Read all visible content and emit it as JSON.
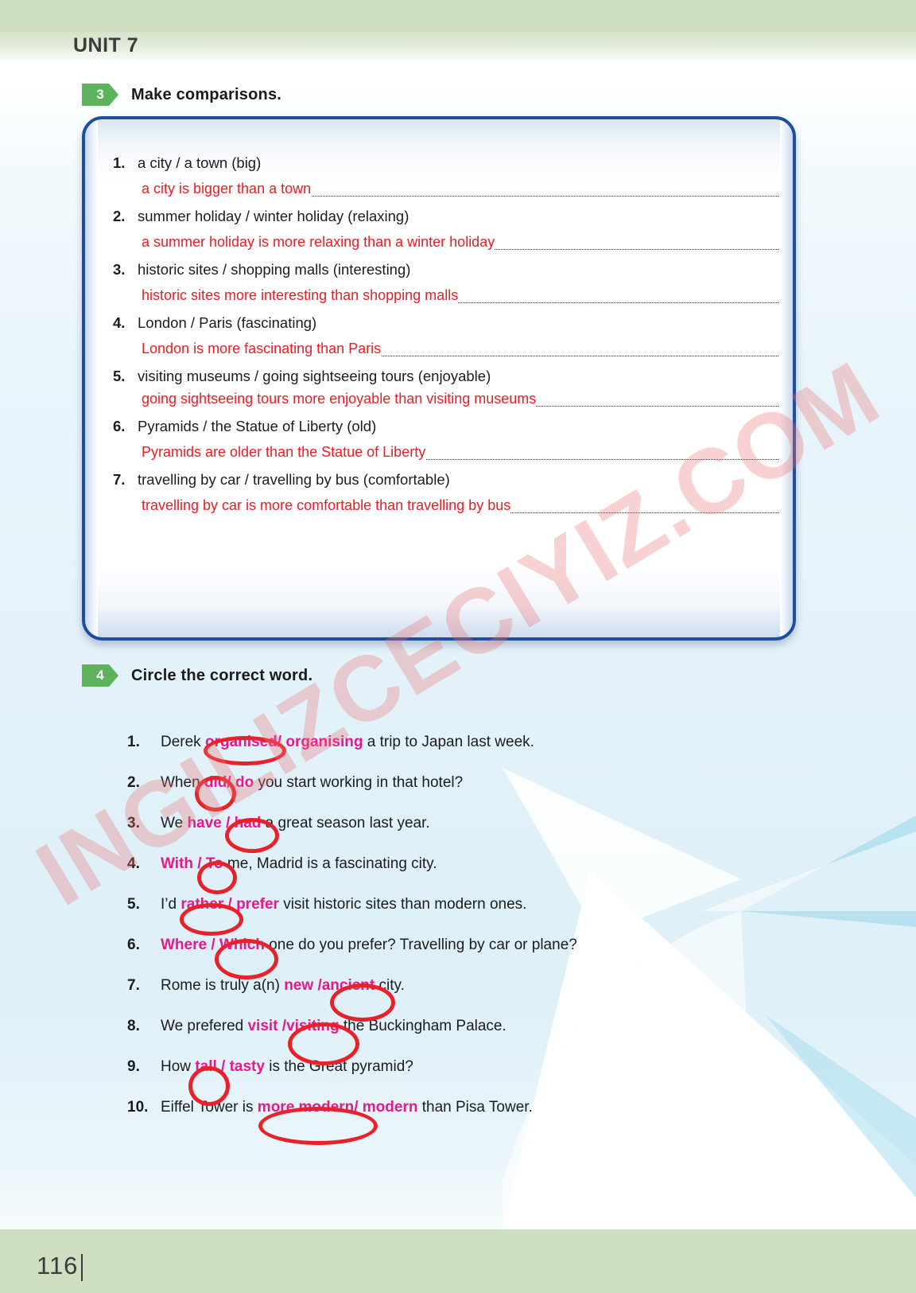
{
  "header": {
    "unit_title": "UNIT 7"
  },
  "footer": {
    "page_number": "116"
  },
  "watermark": {
    "text": "INGILIZCECIYIZ.COM"
  },
  "exercise3": {
    "number": "3",
    "title": "Make comparisons.",
    "items": [
      {
        "num": "1.",
        "prompt": "a city / a town (big)",
        "answer": "a city is bigger than a town",
        "period": "."
      },
      {
        "num": "2.",
        "prompt": "summer holiday / winter holiday (relaxing)",
        "answer": "a summer holiday is more relaxing than a winter holiday",
        "period": "."
      },
      {
        "num": "3.",
        "prompt": "historic sites / shopping malls (interesting)",
        "answer": "historic sites more interesting than shopping malls",
        "period": "."
      },
      {
        "num": "4.",
        "prompt": "London / Paris (fascinating)",
        "answer": "London is more fascinating than Paris",
        "period": "."
      },
      {
        "num": "5.",
        "prompt": "visiting museums / going sightseeing tours (enjoyable)",
        "answer": "going sightseeing tours more enjoyable than visiting museums",
        "period": "."
      },
      {
        "num": "6.",
        "prompt": "Pyramids / the Statue of Liberty (old)",
        "answer": "Pyramids are older than the Statue of Liberty",
        "period": "."
      },
      {
        "num": "7.",
        "prompt": "travelling by car / travelling by bus (comfortable)",
        "answer": "travelling by car is more comfortable than travelling by bus",
        "period": "."
      }
    ]
  },
  "exercise4": {
    "number": "4",
    "title": "Circle the correct word.",
    "separator": "/",
    "items": [
      {
        "num": "1.",
        "pre": "Derek ",
        "option_a": "organised",
        "option_b": "organising",
        "post": " a trip to Japan last week.",
        "circled": "a"
      },
      {
        "num": "2.",
        "pre": "When ",
        "option_a": "did",
        "option_b": "do",
        "post": " you start working in that hotel?",
        "circled": "a"
      },
      {
        "num": "3.",
        "pre": "We ",
        "option_a": "have",
        "option_b": "had",
        "post": " a great season last year.",
        "circled": "b"
      },
      {
        "num": "4.",
        "pre": "",
        "option_a": "With",
        "option_b": "To",
        "post": " me, Madrid is a fascinating city.",
        "circled": "b"
      },
      {
        "num": "5.",
        "pre": "I’d ",
        "option_a": "rather",
        "option_b": "prefer",
        "post": " visit historic sites than modern ones.",
        "circled": "a"
      },
      {
        "num": "6.",
        "pre": "",
        "option_a": "Where",
        "option_b": "Which",
        "post": " one do you prefer? Travelling by car or plane?",
        "circled": "b"
      },
      {
        "num": "7.",
        "pre": "Rome is truly a(n) ",
        "option_a": "new",
        "option_b": "ancient",
        "post": " city.",
        "circled": "b"
      },
      {
        "num": "8.",
        "pre": "We prefered ",
        "option_a": "visit",
        "option_b": "visiting",
        "post": " the Buckingham Palace.",
        "circled": "b"
      },
      {
        "num": "9.",
        "pre": "How ",
        "option_a": "tall",
        "option_b": "tasty",
        "post": " is the Great pyramid?",
        "circled": "a"
      },
      {
        "num": "10.",
        "pre": "Eiffel Tower is ",
        "option_a": "more modern",
        "option_b": "modern",
        "post": " than Pisa Tower.",
        "circled": "a"
      }
    ]
  },
  "colors": {
    "band_green": "#cddfc0",
    "badge_green": "#5cb25d",
    "box_blue": "#1f4e9c",
    "answer_red": "#ec1c24",
    "option_magenta": "#e8188c",
    "circle_red": "#e8222a",
    "watermark_pink": "#e97474"
  }
}
